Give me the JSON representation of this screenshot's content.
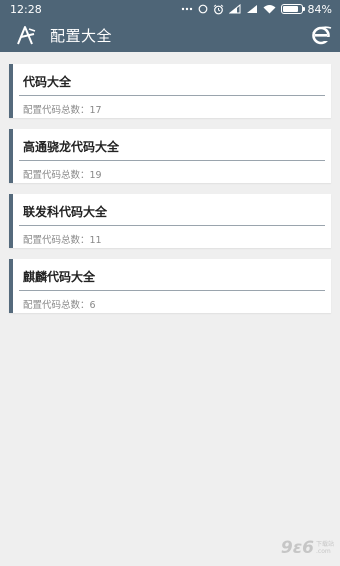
{
  "status_bar": {
    "time": "12:28",
    "battery": "84%",
    "battery_level": 0.84,
    "icons": [
      "more-icon",
      "data-saver-icon",
      "alarm-icon",
      "signal-icon",
      "signal-icon",
      "wifi-icon",
      "battery-icon"
    ]
  },
  "toolbar": {
    "title": "配置大全",
    "left_icon": "app-logo-icon",
    "right_icon": "browser-icon"
  },
  "cards": [
    {
      "title": "代码大全",
      "subtitle": "配置代码总数：17"
    },
    {
      "title": "高通骁龙代码大全",
      "subtitle": "配置代码总数：19"
    },
    {
      "title": "联发科代码大全",
      "subtitle": "配置代码总数：11"
    },
    {
      "title": "麒麟代码大全",
      "subtitle": "配置代码总数：6"
    }
  ],
  "watermark": {
    "mark": "9ε6",
    "line1": "下载站",
    "line2": ".com"
  },
  "colors": {
    "header": "#4e6577",
    "card_accent": "#556a7c",
    "background": "#efefef"
  }
}
